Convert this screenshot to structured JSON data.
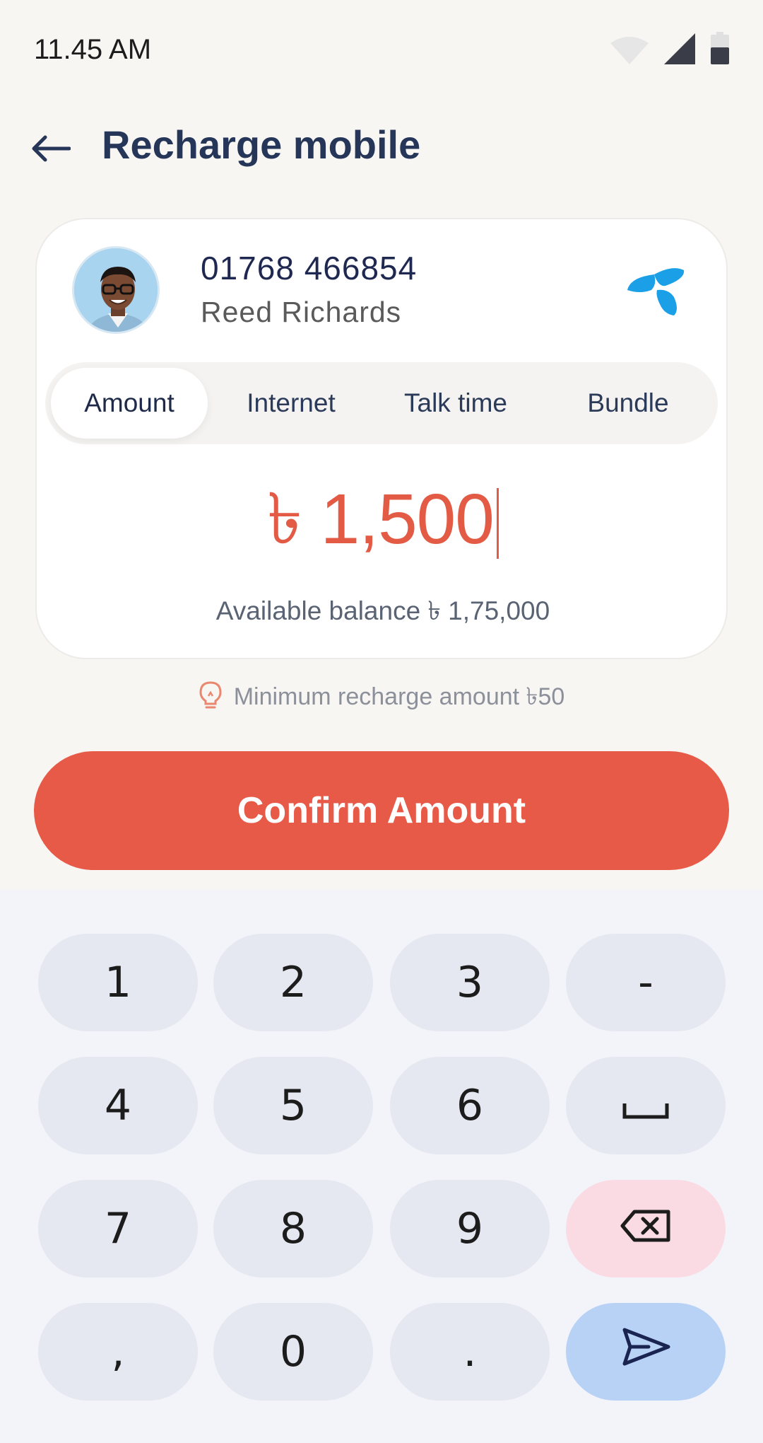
{
  "status_bar": {
    "time": "11.45 AM",
    "icons": [
      "wifi-icon",
      "signal-icon",
      "battery-icon"
    ]
  },
  "header": {
    "back_icon": "arrow-left-icon",
    "title": "Recharge mobile"
  },
  "contact": {
    "number": "01768 466854",
    "name": "Reed Richards",
    "operator_icon": "operator-logo-icon"
  },
  "tabs": [
    {
      "label": "Amount",
      "active": true
    },
    {
      "label": "Internet",
      "active": false
    },
    {
      "label": "Talk time",
      "active": false
    },
    {
      "label": "Bundle",
      "active": false
    }
  ],
  "amount": {
    "value": "৳ 1,500",
    "balance_text": "Available balance ৳ 1,75,000"
  },
  "hint": {
    "icon": "lightbulb-icon",
    "text": "Minimum recharge amount ৳50"
  },
  "confirm_label": "Confirm Amount",
  "keyboard": {
    "keys": [
      "1",
      "2",
      "3",
      "-",
      "4",
      "5",
      "6",
      "␣",
      "7",
      "8",
      "9",
      "backspace",
      ",",
      "0",
      ".",
      "enter"
    ]
  },
  "colors": {
    "accent": "#e85a48",
    "amount_text": "#e35a45",
    "title_text": "#263658",
    "operator_blue": "#1ba0e8",
    "backspace_key": "#fbdbe3",
    "enter_key": "#b8d2f6"
  }
}
